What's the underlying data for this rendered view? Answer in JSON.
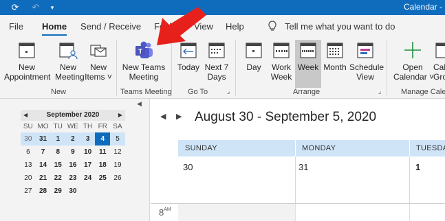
{
  "window": {
    "title": "Calendar - "
  },
  "menu_tabs": [
    {
      "label": "File"
    },
    {
      "label": "Home"
    },
    {
      "label": "Send / Receive"
    },
    {
      "label": "Folder"
    },
    {
      "label": "View"
    },
    {
      "label": "Help"
    }
  ],
  "tell_me": {
    "placeholder": "Tell me what you want to do"
  },
  "ribbon": {
    "new_group": {
      "label": "New",
      "new_appointment": [
        "New",
        "Appointment"
      ],
      "new_meeting": [
        "New",
        "Meeting"
      ],
      "new_items": [
        "New",
        "Items ˅"
      ]
    },
    "teams_group": {
      "label": "Teams Meeting",
      "new_teams_meeting": [
        "New Teams",
        "Meeting"
      ]
    },
    "goto_group": {
      "label": "Go To",
      "today": [
        "Today",
        ""
      ],
      "next7": [
        "Next 7",
        "Days"
      ]
    },
    "arrange_group": {
      "label": "Arrange",
      "day": [
        "Day",
        ""
      ],
      "work_week": [
        "Work",
        "Week"
      ],
      "week": [
        "Week",
        ""
      ],
      "month": [
        "Month",
        ""
      ],
      "schedule_view": [
        "Schedule",
        "View"
      ]
    },
    "manage_group": {
      "label": "Manage Calendars",
      "open_calendar": [
        "Open",
        "Calendar ˅"
      ],
      "calendar_groups": [
        "Cal",
        "Gro"
      ]
    }
  },
  "mini_calendar": {
    "month_label": "September 2020",
    "day_headers": [
      "SU",
      "MO",
      "TU",
      "WE",
      "TH",
      "FR",
      "SA"
    ],
    "weeks": [
      [
        "30",
        "31",
        "1",
        "2",
        "3",
        "4",
        "5"
      ],
      [
        "6",
        "7",
        "8",
        "9",
        "10",
        "11",
        "12"
      ],
      [
        "13",
        "14",
        "15",
        "16",
        "17",
        "18",
        "19"
      ],
      [
        "20",
        "21",
        "22",
        "23",
        "24",
        "25",
        "26"
      ],
      [
        "27",
        "28",
        "29",
        "30",
        "",
        "",
        ""
      ]
    ]
  },
  "calendar": {
    "range_title": "August 30 - September 5, 2020",
    "days": [
      {
        "name": "SUNDAY",
        "date": "30"
      },
      {
        "name": "MONDAY",
        "date": "31"
      },
      {
        "name": "TUESDA",
        "date": "1"
      }
    ],
    "time_label": "8",
    "time_suffix": "AM"
  },
  "colors": {
    "accent": "#0f6cbd",
    "day_header_bg": "#cfe4f7",
    "arrow": "#e8201c"
  }
}
